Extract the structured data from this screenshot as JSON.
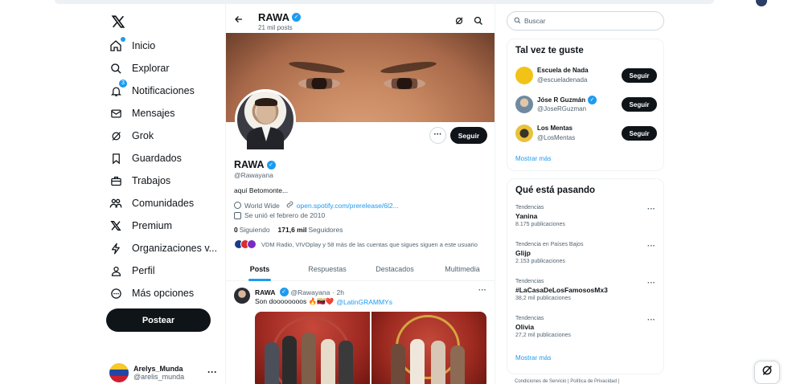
{
  "brand": {
    "accent": "#1d9bf0",
    "text": "#0f1419",
    "muted": "#536471"
  },
  "nav": {
    "logo_icon": "x-logo-icon",
    "items": [
      {
        "label": "Inicio",
        "icon": "home-icon"
      },
      {
        "label": "Explorar",
        "icon": "search-icon"
      },
      {
        "label": "Notificaciones",
        "icon": "bell-icon",
        "badge": "3"
      },
      {
        "label": "Mensajes",
        "icon": "envelope-icon"
      },
      {
        "label": "Grok",
        "icon": "grok-icon"
      },
      {
        "label": "Guardados",
        "icon": "bookmark-icon"
      },
      {
        "label": "Trabajos",
        "icon": "briefcase-icon"
      },
      {
        "label": "Comunidades",
        "icon": "people-icon"
      },
      {
        "label": "Premium",
        "icon": "x-logo-icon"
      },
      {
        "label": "Organizaciones v...",
        "icon": "lightning-icon"
      },
      {
        "label": "Perfil",
        "icon": "person-icon"
      },
      {
        "label": "Más opciones",
        "icon": "more-circle-icon"
      }
    ],
    "post_button": "Postear"
  },
  "account": {
    "name": "Arelys_Munda",
    "handle": "@arelis_munda",
    "more": "···"
  },
  "profile_header": {
    "name": "RAWA",
    "posts_count": "21 mil posts"
  },
  "profile": {
    "name": "RAWA",
    "handle": "@Rawayana",
    "bio": "aquí Betomonte...",
    "location": "World Wide",
    "link": "open.spotify.com/prerelease/6l2...",
    "joined": "Se unió el febrero de 2010",
    "following_count": "0",
    "following_label": "Siguiendo",
    "followers_count": "171,6 mil",
    "followers_label": "Seguidores",
    "followed_by": "VDM Radio, VIVOplay y 58 más de las cuentas que sigues siguen a este usuario",
    "more_button": "···",
    "follow_button": "Seguir"
  },
  "tabs": [
    "Posts",
    "Respuestas",
    "Destacados",
    "Multimedia"
  ],
  "tweet": {
    "name": "RAWA",
    "handle": "@Rawayana",
    "time": "· 2h",
    "text": "Son doooooooos 🔥🇻🇪❤️",
    "mention": "@LatinGRAMMYs",
    "more": "···"
  },
  "right": {
    "search_placeholder": "Buscar",
    "suggestions_title": "Tal vez te guste",
    "suggestions": [
      {
        "name": "Escuela de Nada",
        "handle": "@escueladenada",
        "verified": false,
        "button": "Seguir",
        "color": "#f2c316"
      },
      {
        "name": "Jóse R Guzmán",
        "handle": "@JoseRGuzman",
        "verified": true,
        "button": "Seguir",
        "color": "#6f8aa0"
      },
      {
        "name": "Los Mentas",
        "handle": "@LosMentas",
        "verified": false,
        "button": "Seguir",
        "color": "#e9c23a"
      }
    ],
    "show_more": "Mostrar más",
    "trends_title": "Qué está pasando",
    "trends": [
      {
        "context": "Tendencias",
        "title": "Yanina",
        "count": "8.175 publicaciones"
      },
      {
        "context": "Tendencia en Países Bajos",
        "title": "Glijp",
        "count": "2.153 publicaciones"
      },
      {
        "context": "Tendencias",
        "title": "#LaCasaDeLosFamososMx3",
        "count": "38,2 mil publicaciones"
      },
      {
        "context": "Tendencias",
        "title": "Olivia",
        "count": "27,2 mil publicaciones"
      }
    ],
    "trends_show_more": "Mostrar más",
    "footer": "Condiciones de Servicio  |  Política de Privacidad  |"
  }
}
